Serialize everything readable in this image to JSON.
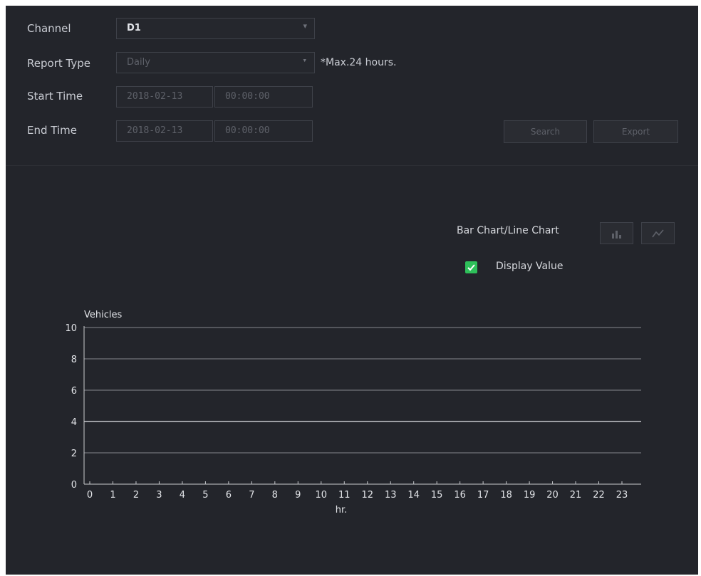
{
  "form": {
    "channel_label": "Channel",
    "channel_value": "D1",
    "report_type_label": "Report Type",
    "report_type_value": "Daily",
    "report_type_note": "*Max.24 hours.",
    "start_time_label": "Start Time",
    "start_date": "2018-02-13",
    "start_time": "00:00:00",
    "end_time_label": "End Time",
    "end_date": "2018-02-13",
    "end_time": "00:00:00",
    "search_button": "Search",
    "export_button": "Export"
  },
  "display": {
    "chart_toggle_label": "Bar Chart/Line Chart",
    "display_value_label": "Display Value",
    "display_value_checked": true
  },
  "colors": {
    "background": "#23252b",
    "checkbox": "#2ec05a",
    "gridline": "#d8dadf"
  },
  "icons": [
    "dropdown-arrow-icon",
    "bar-chart-icon",
    "line-chart-icon",
    "checkbox-checked-icon"
  ],
  "chart_data": {
    "type": "bar",
    "title": "",
    "ylabel": "Vehicles",
    "xlabel": "hr.",
    "categories": [
      "0",
      "1",
      "2",
      "3",
      "4",
      "5",
      "6",
      "7",
      "8",
      "9",
      "10",
      "11",
      "12",
      "13",
      "14",
      "15",
      "16",
      "17",
      "18",
      "19",
      "20",
      "21",
      "22",
      "23"
    ],
    "values": [
      0,
      0,
      0,
      0,
      0,
      0,
      0,
      0,
      0,
      0,
      0,
      0,
      0,
      0,
      0,
      0,
      0,
      0,
      0,
      0,
      0,
      0,
      0,
      0
    ],
    "ylim": [
      0,
      10
    ],
    "yticks": [
      0,
      2,
      4,
      6,
      8,
      10
    ],
    "grid": true
  }
}
